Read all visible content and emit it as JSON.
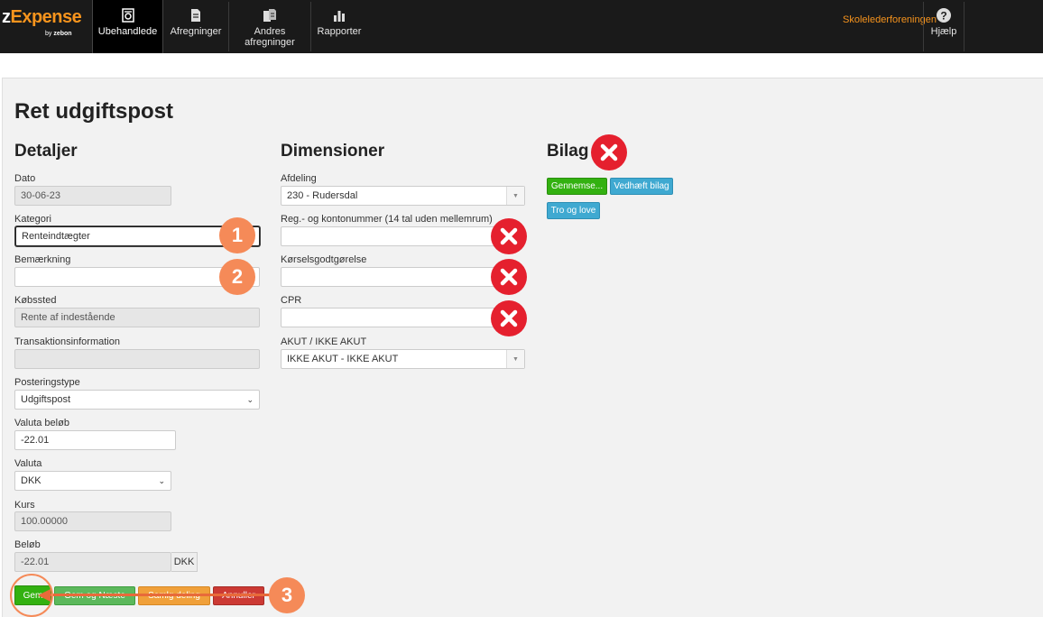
{
  "app": {
    "logo_main_a": "z",
    "logo_main_b": "Expense",
    "logo_sub_a": "by ",
    "logo_sub_b": "zebon"
  },
  "nav": {
    "items": [
      {
        "label": "Ubehandlede",
        "icon": "receipt-camera-icon"
      },
      {
        "label": "Afregninger",
        "icon": "document-icon"
      },
      {
        "label": "Andres afregninger",
        "icon": "documents-icon"
      },
      {
        "label": "Rapporter",
        "icon": "bar-chart-icon"
      }
    ],
    "org": "Skolelederforeningen",
    "help": "Hjælp"
  },
  "page": {
    "title": "Ret udgiftspost"
  },
  "details": {
    "heading": "Detaljer",
    "dato_label": "Dato",
    "dato_value": "30-06-23",
    "kategori_label": "Kategori",
    "kategori_value": "Renteindtægter",
    "bemaerkning_label": "Bemærkning",
    "bemaerkning_value": "",
    "kobssted_label": "Købssted",
    "kobssted_value": "Rente af indestående",
    "transaktion_label": "Transaktionsinformation",
    "transaktion_value": "",
    "posteringstype_label": "Posteringstype",
    "posteringstype_value": "Udgiftspost",
    "valuta_belob_label": "Valuta beløb",
    "valuta_belob_value": "-22.01",
    "valuta_label": "Valuta",
    "valuta_value": "DKK",
    "kurs_label": "Kurs",
    "kurs_value": "100.00000",
    "belob_label": "Beløb",
    "belob_value": "-22.01",
    "belob_currency": "DKK"
  },
  "dimensions": {
    "heading": "Dimensioner",
    "afdeling_label": "Afdeling",
    "afdeling_value": "230 - Rudersdal",
    "reg_label": "Reg.- og kontonummer (14 tal uden mellemrum)",
    "reg_value": "",
    "korsel_label": "Kørselsgodtgørelse",
    "korsel_value": "",
    "cpr_label": "CPR",
    "cpr_value": "",
    "akut_label": "AKUT / IKKE AKUT",
    "akut_value": "IKKE AKUT - IKKE AKUT"
  },
  "bilag": {
    "heading": "Bilag",
    "browse_label": "Gennemse...",
    "attach_label": "Vedhæft bilag",
    "tro_label": "Tro og love"
  },
  "actions": {
    "save_label": "Gem",
    "save_next_label": "Gem og Næste",
    "split_label": "Samlg deling",
    "cancel_label": "Annuller"
  },
  "annotations": {
    "step1": "1",
    "step2": "2",
    "step3": "3"
  },
  "colors": {
    "brand_orange": "#f7941d",
    "error_red": "#e5202e",
    "annotation_orange": "#f58a58"
  }
}
